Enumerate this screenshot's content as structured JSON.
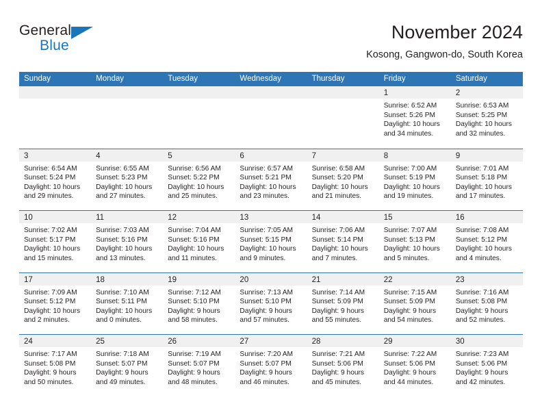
{
  "brand": {
    "name_top": "General",
    "name_bottom": "Blue",
    "accent_color": "#1b75bb"
  },
  "header": {
    "title": "November 2024",
    "subtitle": "Kosong, Gangwon-do, South Korea"
  },
  "theme": {
    "header_row_color": "#2e75b6",
    "day_number_band": "#f0f0f0",
    "text_color": "#231f20"
  },
  "weekdays": [
    "Sunday",
    "Monday",
    "Tuesday",
    "Wednesday",
    "Thursday",
    "Friday",
    "Saturday"
  ],
  "weeks": [
    [
      {
        "day": "",
        "sunrise": "",
        "sunset": "",
        "daylight": "",
        "empty": true
      },
      {
        "day": "",
        "sunrise": "",
        "sunset": "",
        "daylight": "",
        "empty": true
      },
      {
        "day": "",
        "sunrise": "",
        "sunset": "",
        "daylight": "",
        "empty": true
      },
      {
        "day": "",
        "sunrise": "",
        "sunset": "",
        "daylight": "",
        "empty": true
      },
      {
        "day": "",
        "sunrise": "",
        "sunset": "",
        "daylight": "",
        "empty": true
      },
      {
        "day": "1",
        "sunrise": "Sunrise: 6:52 AM",
        "sunset": "Sunset: 5:26 PM",
        "daylight": "Daylight: 10 hours and 34 minutes."
      },
      {
        "day": "2",
        "sunrise": "Sunrise: 6:53 AM",
        "sunset": "Sunset: 5:25 PM",
        "daylight": "Daylight: 10 hours and 32 minutes."
      }
    ],
    [
      {
        "day": "3",
        "sunrise": "Sunrise: 6:54 AM",
        "sunset": "Sunset: 5:24 PM",
        "daylight": "Daylight: 10 hours and 29 minutes."
      },
      {
        "day": "4",
        "sunrise": "Sunrise: 6:55 AM",
        "sunset": "Sunset: 5:23 PM",
        "daylight": "Daylight: 10 hours and 27 minutes."
      },
      {
        "day": "5",
        "sunrise": "Sunrise: 6:56 AM",
        "sunset": "Sunset: 5:22 PM",
        "daylight": "Daylight: 10 hours and 25 minutes."
      },
      {
        "day": "6",
        "sunrise": "Sunrise: 6:57 AM",
        "sunset": "Sunset: 5:21 PM",
        "daylight": "Daylight: 10 hours and 23 minutes."
      },
      {
        "day": "7",
        "sunrise": "Sunrise: 6:58 AM",
        "sunset": "Sunset: 5:20 PM",
        "daylight": "Daylight: 10 hours and 21 minutes."
      },
      {
        "day": "8",
        "sunrise": "Sunrise: 7:00 AM",
        "sunset": "Sunset: 5:19 PM",
        "daylight": "Daylight: 10 hours and 19 minutes."
      },
      {
        "day": "9",
        "sunrise": "Sunrise: 7:01 AM",
        "sunset": "Sunset: 5:18 PM",
        "daylight": "Daylight: 10 hours and 17 minutes."
      }
    ],
    [
      {
        "day": "10",
        "sunrise": "Sunrise: 7:02 AM",
        "sunset": "Sunset: 5:17 PM",
        "daylight": "Daylight: 10 hours and 15 minutes."
      },
      {
        "day": "11",
        "sunrise": "Sunrise: 7:03 AM",
        "sunset": "Sunset: 5:16 PM",
        "daylight": "Daylight: 10 hours and 13 minutes."
      },
      {
        "day": "12",
        "sunrise": "Sunrise: 7:04 AM",
        "sunset": "Sunset: 5:16 PM",
        "daylight": "Daylight: 10 hours and 11 minutes."
      },
      {
        "day": "13",
        "sunrise": "Sunrise: 7:05 AM",
        "sunset": "Sunset: 5:15 PM",
        "daylight": "Daylight: 10 hours and 9 minutes."
      },
      {
        "day": "14",
        "sunrise": "Sunrise: 7:06 AM",
        "sunset": "Sunset: 5:14 PM",
        "daylight": "Daylight: 10 hours and 7 minutes."
      },
      {
        "day": "15",
        "sunrise": "Sunrise: 7:07 AM",
        "sunset": "Sunset: 5:13 PM",
        "daylight": "Daylight: 10 hours and 5 minutes."
      },
      {
        "day": "16",
        "sunrise": "Sunrise: 7:08 AM",
        "sunset": "Sunset: 5:12 PM",
        "daylight": "Daylight: 10 hours and 4 minutes."
      }
    ],
    [
      {
        "day": "17",
        "sunrise": "Sunrise: 7:09 AM",
        "sunset": "Sunset: 5:12 PM",
        "daylight": "Daylight: 10 hours and 2 minutes."
      },
      {
        "day": "18",
        "sunrise": "Sunrise: 7:10 AM",
        "sunset": "Sunset: 5:11 PM",
        "daylight": "Daylight: 10 hours and 0 minutes."
      },
      {
        "day": "19",
        "sunrise": "Sunrise: 7:12 AM",
        "sunset": "Sunset: 5:10 PM",
        "daylight": "Daylight: 9 hours and 58 minutes."
      },
      {
        "day": "20",
        "sunrise": "Sunrise: 7:13 AM",
        "sunset": "Sunset: 5:10 PM",
        "daylight": "Daylight: 9 hours and 57 minutes."
      },
      {
        "day": "21",
        "sunrise": "Sunrise: 7:14 AM",
        "sunset": "Sunset: 5:09 PM",
        "daylight": "Daylight: 9 hours and 55 minutes."
      },
      {
        "day": "22",
        "sunrise": "Sunrise: 7:15 AM",
        "sunset": "Sunset: 5:09 PM",
        "daylight": "Daylight: 9 hours and 54 minutes."
      },
      {
        "day": "23",
        "sunrise": "Sunrise: 7:16 AM",
        "sunset": "Sunset: 5:08 PM",
        "daylight": "Daylight: 9 hours and 52 minutes."
      }
    ],
    [
      {
        "day": "24",
        "sunrise": "Sunrise: 7:17 AM",
        "sunset": "Sunset: 5:08 PM",
        "daylight": "Daylight: 9 hours and 50 minutes."
      },
      {
        "day": "25",
        "sunrise": "Sunrise: 7:18 AM",
        "sunset": "Sunset: 5:07 PM",
        "daylight": "Daylight: 9 hours and 49 minutes."
      },
      {
        "day": "26",
        "sunrise": "Sunrise: 7:19 AM",
        "sunset": "Sunset: 5:07 PM",
        "daylight": "Daylight: 9 hours and 48 minutes."
      },
      {
        "day": "27",
        "sunrise": "Sunrise: 7:20 AM",
        "sunset": "Sunset: 5:07 PM",
        "daylight": "Daylight: 9 hours and 46 minutes."
      },
      {
        "day": "28",
        "sunrise": "Sunrise: 7:21 AM",
        "sunset": "Sunset: 5:06 PM",
        "daylight": "Daylight: 9 hours and 45 minutes."
      },
      {
        "day": "29",
        "sunrise": "Sunrise: 7:22 AM",
        "sunset": "Sunset: 5:06 PM",
        "daylight": "Daylight: 9 hours and 44 minutes."
      },
      {
        "day": "30",
        "sunrise": "Sunrise: 7:23 AM",
        "sunset": "Sunset: 5:06 PM",
        "daylight": "Daylight: 9 hours and 42 minutes."
      }
    ]
  ]
}
